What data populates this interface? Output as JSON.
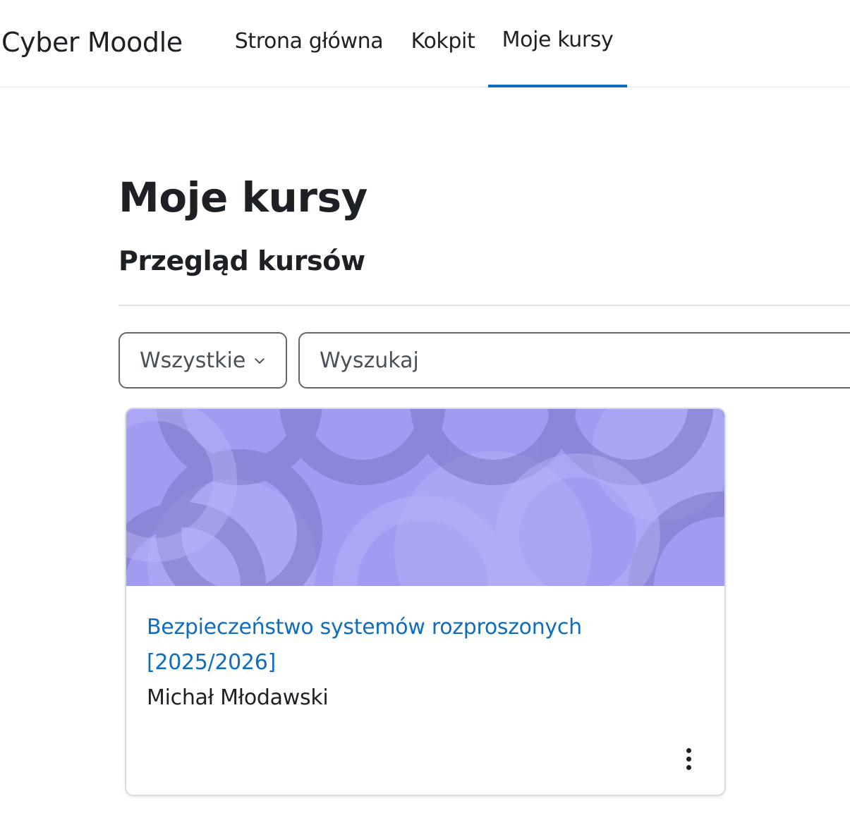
{
  "header": {
    "brand": "Cyber Moodle",
    "nav": [
      {
        "label": "Strona główna",
        "active": false
      },
      {
        "label": "Kokpit",
        "active": false
      },
      {
        "label": "Moje kursy",
        "active": true
      }
    ],
    "accent_color": "#0f6cbf"
  },
  "page": {
    "title": "Moje kursy",
    "section_title": "Przegląd kursów"
  },
  "filters": {
    "grouping_value": "Wszystkie",
    "grouping_icon": "chevron-down-icon",
    "search_placeholder": "Wyszukaj",
    "search_value": ""
  },
  "courses": [
    {
      "name": "Bezpieczeństwo systemów rozproszonych [2025/2026]",
      "teacher": "Michał Młodawski",
      "image_color": "#a09cf2",
      "menu_icon": "more-vertical-icon"
    }
  ],
  "colors": {
    "link": "#0f6cbf",
    "text": "#1d2125",
    "border": "#dee2e6"
  }
}
